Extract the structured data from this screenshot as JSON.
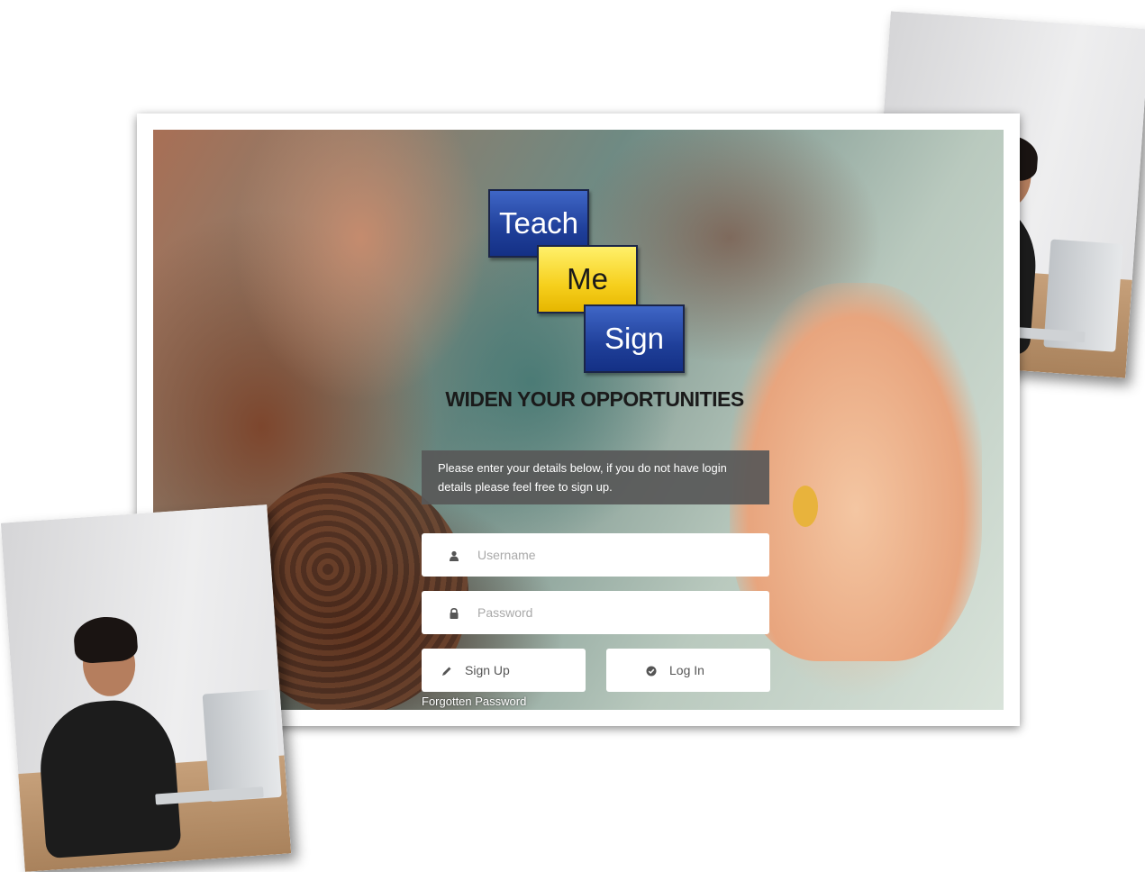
{
  "logo": {
    "word1": "Teach",
    "word2": "Me",
    "word3": "Sign",
    "colors": {
      "blue": "#1f3f99",
      "yellow": "#f6cf1c"
    }
  },
  "slogan": "WIDEN YOUR OPPORTUNITIES",
  "info_text": "Please enter your details below, if you do not have login details please feel free to sign up.",
  "form": {
    "username_placeholder": "Username",
    "password_placeholder": "Password",
    "icons": {
      "username": "user-icon",
      "password": "lock-icon",
      "signup": "pencil-icon",
      "login": "check-circle-icon"
    }
  },
  "buttons": {
    "signup_label": "Sign Up",
    "login_label": "Log In"
  },
  "forgot_link": "Forgotten Password"
}
